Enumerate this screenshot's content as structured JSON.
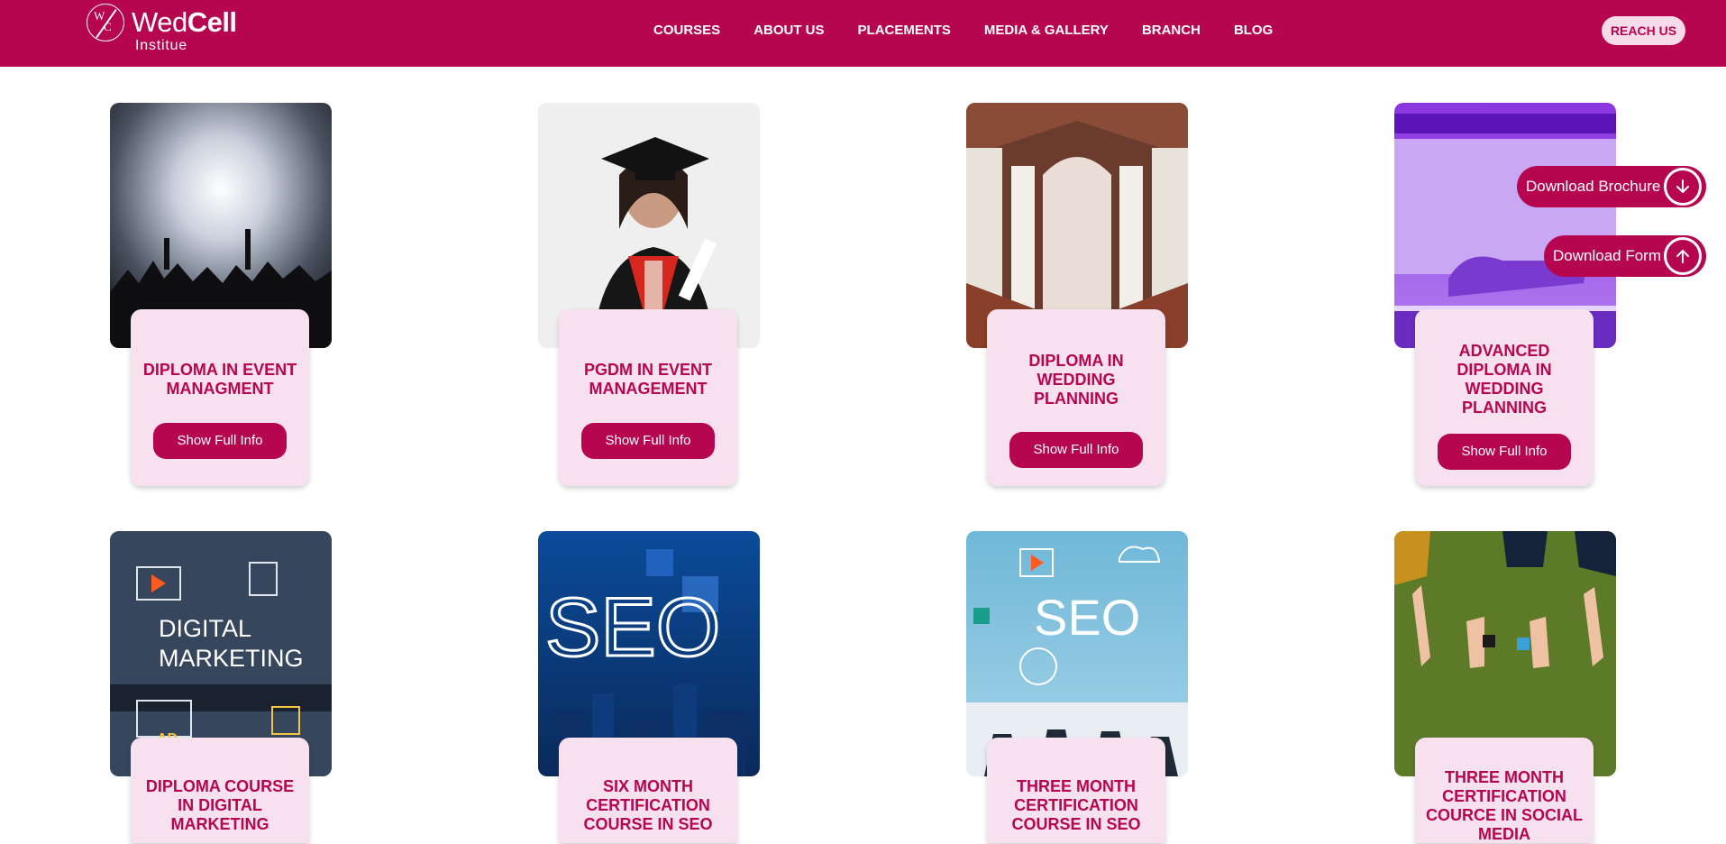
{
  "header": {
    "brand_light": "Wed",
    "brand_bold": "Cell",
    "brand_sub": "Institue",
    "logo_letter_1": "W",
    "logo_letter_2": "C",
    "nav": [
      "COURSES",
      "ABOUT US",
      "PLACEMENTS",
      "MEDIA & GALLERY",
      "BRANCH",
      "BLOG"
    ],
    "cta": "REACH US"
  },
  "courses": [
    {
      "title": "DIPLOMA IN EVENT MANAGMENT",
      "button": "Show Full Info",
      "image": "concert-crowd-image"
    },
    {
      "title": "PGDM IN EVENT MANAGEMENT",
      "button": "Show Full Info",
      "image": "graduate-student-image"
    },
    {
      "title": "DIPLOMA IN WEDDING PLANNING",
      "button": "Show Full Info",
      "image": "wedding-aisle-image"
    },
    {
      "title": "ADVANCED DIPLOMA IN WEDDING PLANNING",
      "button": "Show Full Info",
      "image": "wedding-stage-image"
    },
    {
      "title": "DIPLOMA COURSE IN DIGITAL MARKETING",
      "image": "digital-marketing-image",
      "image_text": "DIGITAL MARKETING"
    },
    {
      "title": "SIX MONTH CERTIFICATION COURSE IN SEO",
      "image": "seo-city-image",
      "image_text": "SEO"
    },
    {
      "title": "THREE MONTH CERTIFICATION COURSE IN SEO",
      "image": "seo-meeting-image",
      "image_text": "SEO"
    },
    {
      "title": "THREE MONTH CERTIFICATION COURCE IN SOCIAL MEDIA",
      "image": "social-media-grass-image"
    }
  ],
  "floating": {
    "brochure": "Download Brochure",
    "form": "Download Form"
  },
  "colors": {
    "brand": "#b5064f",
    "card_bg": "#f8e1ee"
  }
}
